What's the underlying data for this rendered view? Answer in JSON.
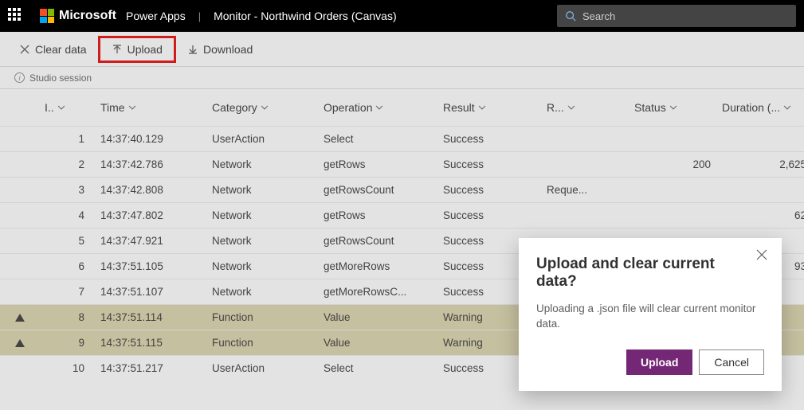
{
  "header": {
    "brand": "Microsoft",
    "app": "Power Apps",
    "page": "Monitor - Northwind Orders (Canvas)",
    "search_placeholder": "Search"
  },
  "toolbar": {
    "clear": "Clear data",
    "upload": "Upload",
    "download": "Download"
  },
  "session": {
    "label": "Studio session"
  },
  "columns": {
    "idx": "I..",
    "time": "Time",
    "category": "Category",
    "operation": "Operation",
    "result": "Result",
    "r": "R...",
    "status": "Status",
    "duration": "Duration (..."
  },
  "rows": [
    {
      "flag": "",
      "idx": "1",
      "time": "14:37:40.129",
      "category": "UserAction",
      "operation": "Select",
      "result": "Success",
      "r": "",
      "status": "",
      "duration": ""
    },
    {
      "flag": "",
      "idx": "2",
      "time": "14:37:42.786",
      "category": "Network",
      "operation": "getRows",
      "result": "Success",
      "r": "",
      "status": "200",
      "duration": "2,625"
    },
    {
      "flag": "",
      "idx": "3",
      "time": "14:37:42.808",
      "category": "Network",
      "operation": "getRowsCount",
      "result": "Success",
      "r": "Reque...",
      "status": "",
      "duration": ""
    },
    {
      "flag": "",
      "idx": "4",
      "time": "14:37:47.802",
      "category": "Network",
      "operation": "getRows",
      "result": "Success",
      "r": "",
      "status": "",
      "duration": "62"
    },
    {
      "flag": "",
      "idx": "5",
      "time": "14:37:47.921",
      "category": "Network",
      "operation": "getRowsCount",
      "result": "Success",
      "r": "",
      "status": "",
      "duration": ""
    },
    {
      "flag": "",
      "idx": "6",
      "time": "14:37:51.105",
      "category": "Network",
      "operation": "getMoreRows",
      "result": "Success",
      "r": "",
      "status": "",
      "duration": "93"
    },
    {
      "flag": "",
      "idx": "7",
      "time": "14:37:51.107",
      "category": "Network",
      "operation": "getMoreRowsC...",
      "result": "Success",
      "r": "",
      "status": "",
      "duration": ""
    },
    {
      "flag": "warn",
      "idx": "8",
      "time": "14:37:51.114",
      "category": "Function",
      "operation": "Value",
      "result": "Warning",
      "r": "",
      "status": "",
      "duration": ""
    },
    {
      "flag": "warn",
      "idx": "9",
      "time": "14:37:51.115",
      "category": "Function",
      "operation": "Value",
      "result": "Warning",
      "r": "",
      "status": "",
      "duration": ""
    },
    {
      "flag": "",
      "idx": "10",
      "time": "14:37:51.217",
      "category": "UserAction",
      "operation": "Select",
      "result": "Success",
      "r": "",
      "status": "",
      "duration": ""
    }
  ],
  "dialog": {
    "title": "Upload and clear current data?",
    "body": "Uploading a .json file will clear current monitor data.",
    "primary": "Upload",
    "secondary": "Cancel"
  }
}
